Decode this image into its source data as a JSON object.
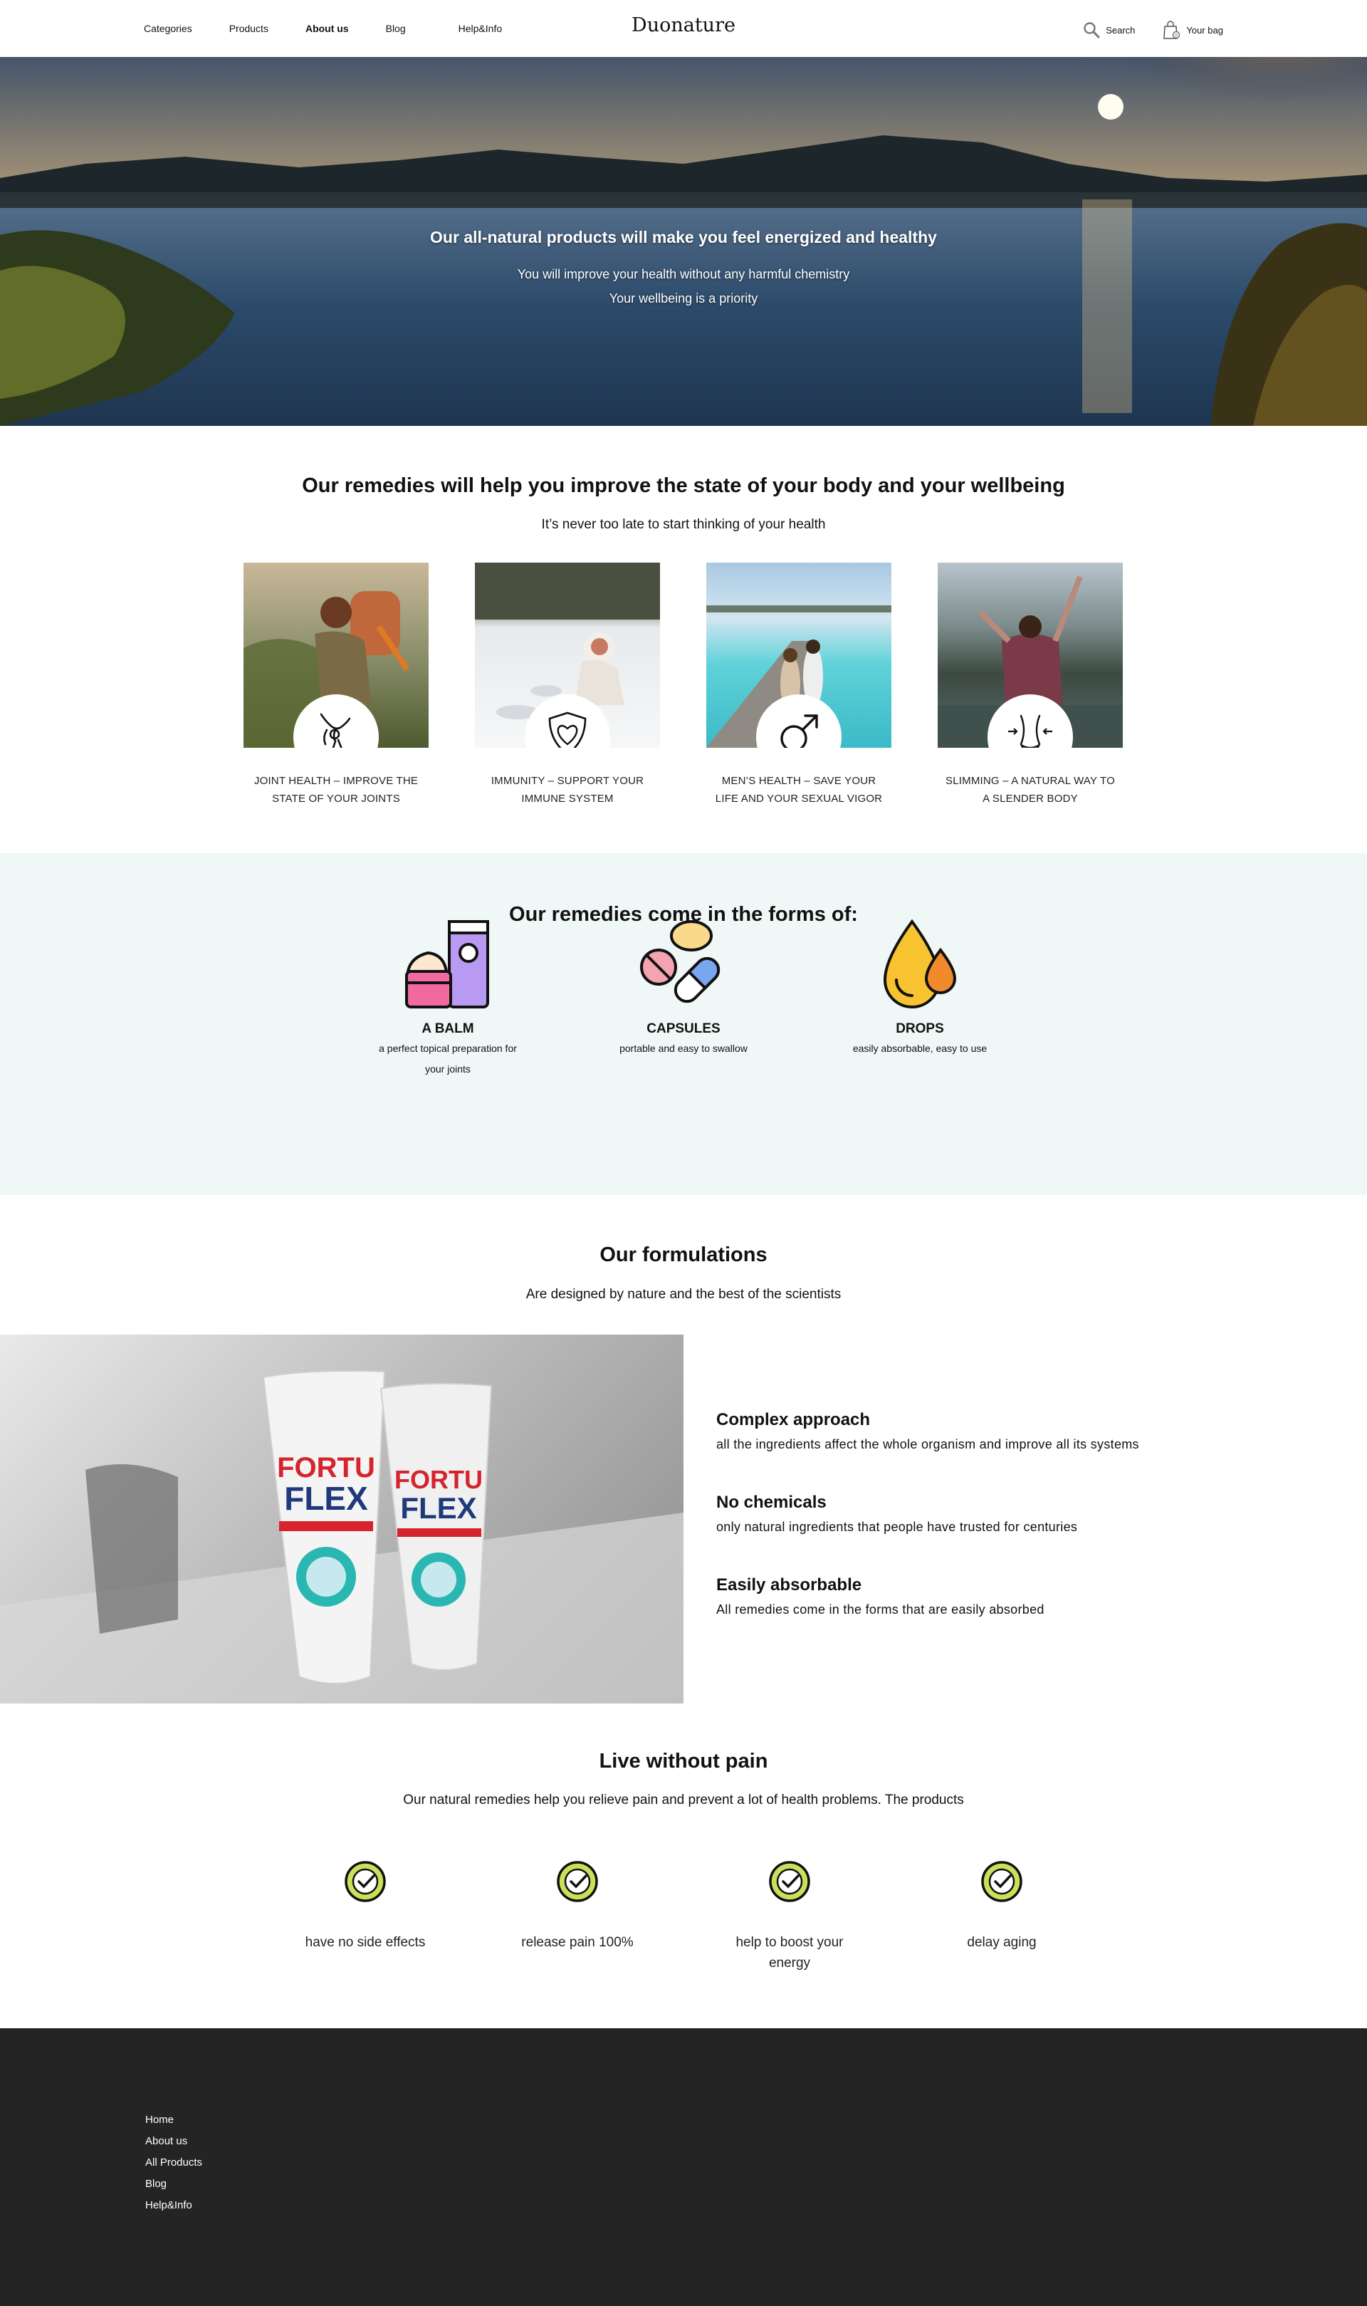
{
  "header": {
    "nav": [
      "Categories",
      "Products",
      "About us",
      "Blog",
      "Help&Info"
    ],
    "logo": "Duonature",
    "search_label": "Search",
    "bag_label": "Your bag"
  },
  "hero": {
    "title": "Our all-natural products will make you feel energized and healthy",
    "line1": "You will improve your health without any harmful chemistry",
    "line2": "Your wellbeing is a priority"
  },
  "benefits": {
    "title": "Our remedies will help you improve the state of your body and your wellbeing",
    "subtitle": "It’s never too late to start thinking of your health",
    "cards": [
      {
        "line1": "Joint health – improve the",
        "line2": "state of your joints",
        "icon": "joint-icon"
      },
      {
        "line1": "Immunity – support your",
        "line2": "immune system",
        "icon": "shield-heart-icon"
      },
      {
        "line1": "Men’s health – save your",
        "line2": "life and your sexual vigor",
        "icon": "male-symbol-icon"
      },
      {
        "line1": "Slimming – a natural way to",
        "line2": "a slender body",
        "icon": "waist-icon"
      }
    ]
  },
  "forms": {
    "title": "Our remedies come in the forms of:",
    "items": [
      {
        "name": "A BALM",
        "desc1": "a perfect topical preparation for",
        "desc2": "your joints",
        "icon": "balm-icon"
      },
      {
        "name": "CAPSULES",
        "desc1": "portable and easy to swallow",
        "desc2": "",
        "icon": "capsules-icon"
      },
      {
        "name": "DROPS",
        "desc1": "easily absorbable, easy to use",
        "desc2": "",
        "icon": "drops-icon"
      }
    ]
  },
  "formulations": {
    "title": "Our formulations",
    "subtitle": "Are designed by nature and the best of the scientists",
    "product_brand": "FORTU",
    "product_brand2": "FLEX",
    "features": [
      {
        "title": "Complex approach",
        "desc": "all the ingredients affect the whole organism and improve all its systems"
      },
      {
        "title": "No chemicals",
        "desc": "only natural ingredients that people have trusted for centuries"
      },
      {
        "title": "Easily absorbable",
        "desc": "All remedies come in the forms that are easily absorbed"
      }
    ]
  },
  "pain": {
    "title": "Live without pain",
    "subtitle": "Our natural remedies help you relieve pain and prevent a lot of health problems.  The products",
    "checks": [
      {
        "line1": "have no side effects",
        "line2": ""
      },
      {
        "line1": "release pain 100%",
        "line2": ""
      },
      {
        "line1": "help to boost your",
        "line2": "energy"
      },
      {
        "line1": "delay aging",
        "line2": ""
      }
    ]
  },
  "footer": {
    "links": [
      "Home",
      "About us",
      "All Products",
      "Blog",
      "Help&Info"
    ]
  },
  "colors": {
    "footer_bg": "#242424",
    "forms_bg": "#f0f7f7",
    "check_green": "#c8e05a",
    "balm_pink": "#f06aa0",
    "balm_purple": "#b89af2",
    "capsule_blue": "#7aa6f0",
    "drop_yellow": "#f7c331",
    "drop_orange": "#f08a2c"
  }
}
